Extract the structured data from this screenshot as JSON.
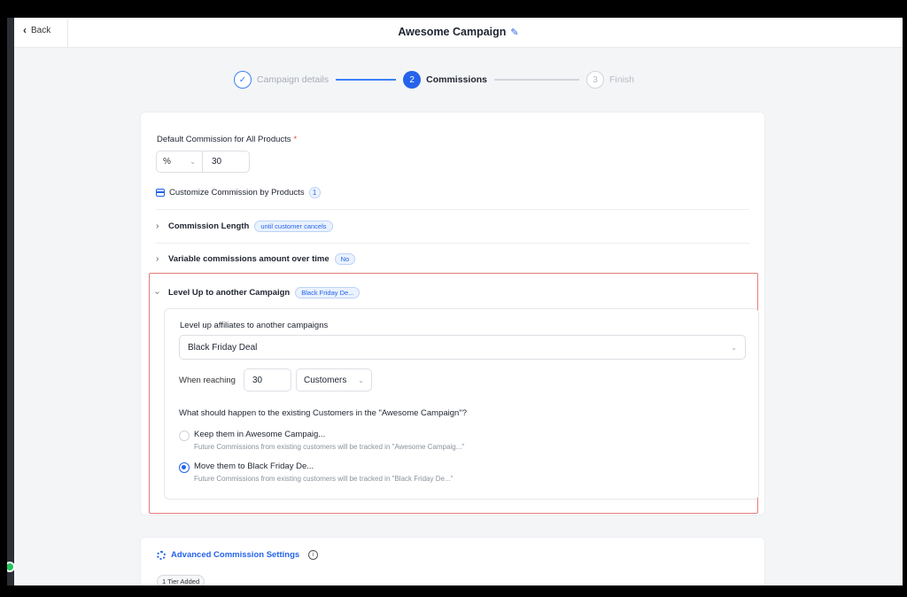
{
  "header": {
    "back_label": "Back",
    "title": "Awesome Campaign"
  },
  "stepper": {
    "steps": [
      {
        "number": "✓",
        "label": "Campaign details",
        "state": "done"
      },
      {
        "number": "2",
        "label": "Commissions",
        "state": "active"
      },
      {
        "number": "3",
        "label": "Finish",
        "state": "todo"
      }
    ]
  },
  "default_commission": {
    "label": "Default Commission for All Products",
    "required_mark": "*",
    "unit": "%",
    "value": "30"
  },
  "customize": {
    "label": "Customize Commission by Products",
    "count": "1"
  },
  "commission_length": {
    "label": "Commission Length",
    "badge": "until customer cancels"
  },
  "variable_commissions": {
    "label": "Variable commissions amount over time",
    "badge": "No"
  },
  "level_up": {
    "label": "Level Up to another Campaign",
    "badge": "Black Friday De...",
    "target_label": "Level up affiliates to another campaigns",
    "target_value": "Black Friday Deal",
    "reaching_label": "When reaching",
    "reaching_value": "30",
    "reaching_unit": "Customers",
    "question": "What should happen to the existing Customers in the \"Awesome Campaign\"?",
    "options": [
      {
        "title": "Keep them in Awesome Campaig...",
        "description": "Future Commissions from existing customers will be tracked in \"Awesome Campaig...\"",
        "selected": false
      },
      {
        "title": "Move them to Black Friday De...",
        "description": "Future Commissions from existing customers will be tracked in \"Black Friday De...\"",
        "selected": true
      }
    ]
  },
  "advanced": {
    "label": "Advanced Commission Settings",
    "tier_badge": "1 Tier Added"
  },
  "colors": {
    "accent": "#2563eb",
    "highlight_border": "#e67a7a",
    "required": "#ef4444"
  }
}
